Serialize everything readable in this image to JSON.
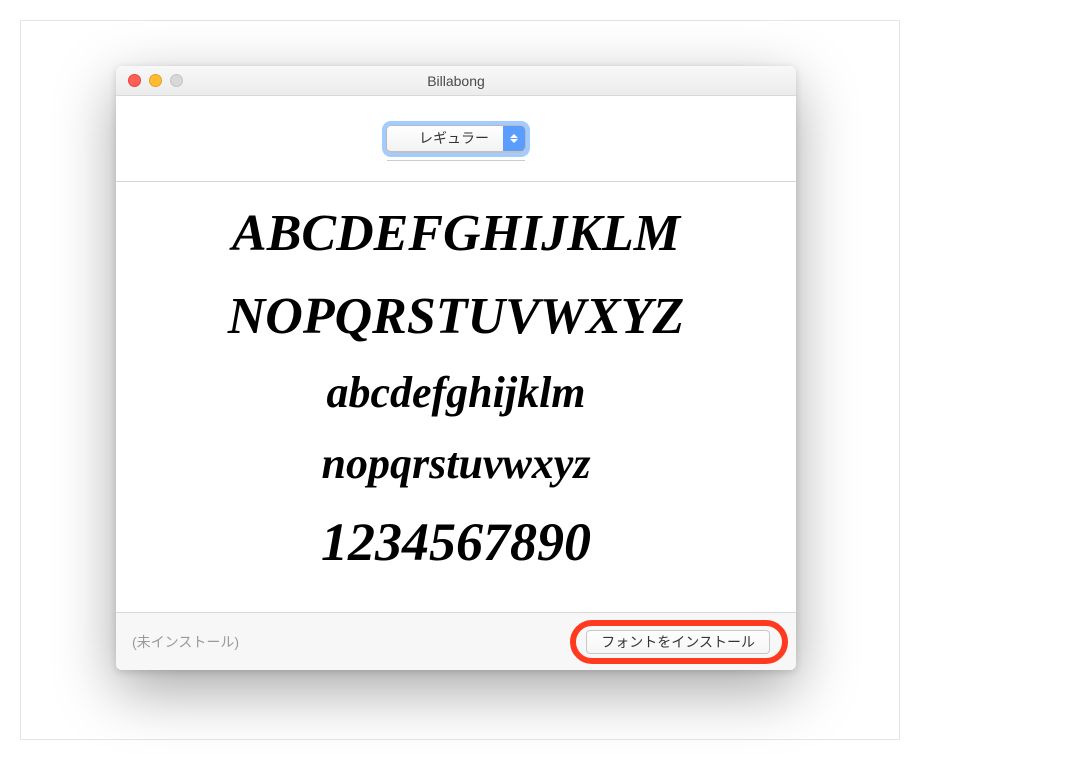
{
  "window": {
    "title": "Billabong"
  },
  "toolbar": {
    "style_select": {
      "selected_label": "レギュラー"
    }
  },
  "preview": {
    "line1": "ABCDEFGHIJKLM",
    "line2": "NOPQRSTUVWXYZ",
    "line3": "abcdefghijklm",
    "line4": "nopqrstuvwxyz",
    "line5": "1234567890"
  },
  "footer": {
    "status_text": "(未インストール)",
    "install_button_label": "フォントをインストール"
  }
}
